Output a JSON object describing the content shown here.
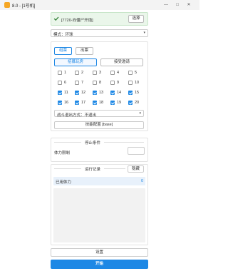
{
  "window": {
    "title": "8.0 - [1号机]",
    "controls": {
      "minimize": "—",
      "maximize": "□",
      "close": "✕"
    }
  },
  "status": {
    "text": "[7720-向僵尸开炮]",
    "select_label": "选择",
    "icon": "check-icon",
    "bg_color": "#eaf6ea",
    "check_color": "#2e7d32"
  },
  "mode": {
    "label": "模式：环球"
  },
  "tabs": [
    {
      "label": "组票"
    },
    {
      "label": "出票"
    }
  ],
  "subtabs": [
    {
      "label": "招募玩房"
    },
    {
      "label": "接受邀请"
    }
  ],
  "checkboxes": [
    {
      "label": "1",
      "checked": false
    },
    {
      "label": "2",
      "checked": false
    },
    {
      "label": "3",
      "checked": false
    },
    {
      "label": "4",
      "checked": false
    },
    {
      "label": "5",
      "checked": false
    },
    {
      "label": "6",
      "checked": false
    },
    {
      "label": "7",
      "checked": false
    },
    {
      "label": "8",
      "checked": false
    },
    {
      "label": "9",
      "checked": false
    },
    {
      "label": "10",
      "checked": false
    },
    {
      "label": "11",
      "checked": true
    },
    {
      "label": "12",
      "checked": true
    },
    {
      "label": "13",
      "checked": true
    },
    {
      "label": "14",
      "checked": true
    },
    {
      "label": "15",
      "checked": true
    },
    {
      "label": "16",
      "checked": true
    },
    {
      "label": "17",
      "checked": true
    },
    {
      "label": "18",
      "checked": true
    },
    {
      "label": "19",
      "checked": true
    },
    {
      "label": "20",
      "checked": true
    }
  ],
  "exit": {
    "label": "战斗退出方式：不退出"
  },
  "skill_button": "技能配置 [base]",
  "stop": {
    "title": "停止条件",
    "stamina_label": "体力限制",
    "stamina_value": ""
  },
  "log": {
    "title": "运行记录",
    "hide_label": "隐藏",
    "row_key": "已用体力",
    "row_value": "0"
  },
  "settings_label": "设置",
  "start_label": "开始",
  "accent_color": "#1e88e5"
}
